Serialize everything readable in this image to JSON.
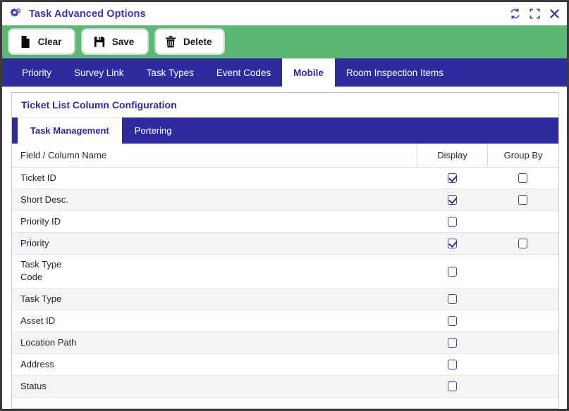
{
  "window": {
    "title": "Task Advanced Options",
    "title_icon": "gears-icon",
    "actions": [
      {
        "name": "refresh-icon",
        "label": "Refresh"
      },
      {
        "name": "maximize-icon",
        "label": "Maximize"
      },
      {
        "name": "close-icon",
        "label": "Close"
      }
    ]
  },
  "toolbar": {
    "buttons": [
      {
        "label": "Clear",
        "icon": "page-icon"
      },
      {
        "label": "Save",
        "icon": "floppy-disk-icon"
      },
      {
        "label": "Delete",
        "icon": "trash-icon"
      }
    ]
  },
  "tabs": {
    "items": [
      {
        "label": "Priority",
        "active": false
      },
      {
        "label": "Survey Link",
        "active": false
      },
      {
        "label": "Task Types",
        "active": false
      },
      {
        "label": "Event Codes",
        "active": false
      },
      {
        "label": "Mobile",
        "active": true
      },
      {
        "label": "Room Inspection Items",
        "active": false
      }
    ]
  },
  "panel": {
    "header": "Ticket List Column Configuration",
    "inner_tabs": [
      {
        "label": "Task Management",
        "active": true
      },
      {
        "label": "Portering",
        "active": false
      }
    ]
  },
  "table": {
    "columns": [
      "Field / Column Name",
      "Display",
      "Group By"
    ],
    "rows": [
      {
        "name": "Ticket ID",
        "display": true,
        "group_by": false,
        "has_group_by": true,
        "tall": false
      },
      {
        "name": "Short Desc.",
        "display": true,
        "group_by": false,
        "has_group_by": true,
        "tall": false
      },
      {
        "name": "Priority ID",
        "display": false,
        "group_by": false,
        "has_group_by": false,
        "tall": false
      },
      {
        "name": "Priority",
        "display": true,
        "group_by": false,
        "has_group_by": true,
        "tall": false
      },
      {
        "name": "Task Type\nCode",
        "display": false,
        "group_by": false,
        "has_group_by": false,
        "tall": true
      },
      {
        "name": "Task Type",
        "display": false,
        "group_by": false,
        "has_group_by": false,
        "tall": false
      },
      {
        "name": "Asset ID",
        "display": false,
        "group_by": false,
        "has_group_by": false,
        "tall": false
      },
      {
        "name": "Location Path",
        "display": false,
        "group_by": false,
        "has_group_by": false,
        "tall": false
      },
      {
        "name": "Address",
        "display": false,
        "group_by": false,
        "has_group_by": false,
        "tall": false
      },
      {
        "name": "Status",
        "display": false,
        "group_by": false,
        "has_group_by": false,
        "tall": false
      }
    ]
  },
  "colors": {
    "navy": "#2e2aa0",
    "green": "#5cb974",
    "title_text": "#3b35b0",
    "checkbox_border": "#3f3fb0",
    "row_alt": "#f5f5f7"
  }
}
